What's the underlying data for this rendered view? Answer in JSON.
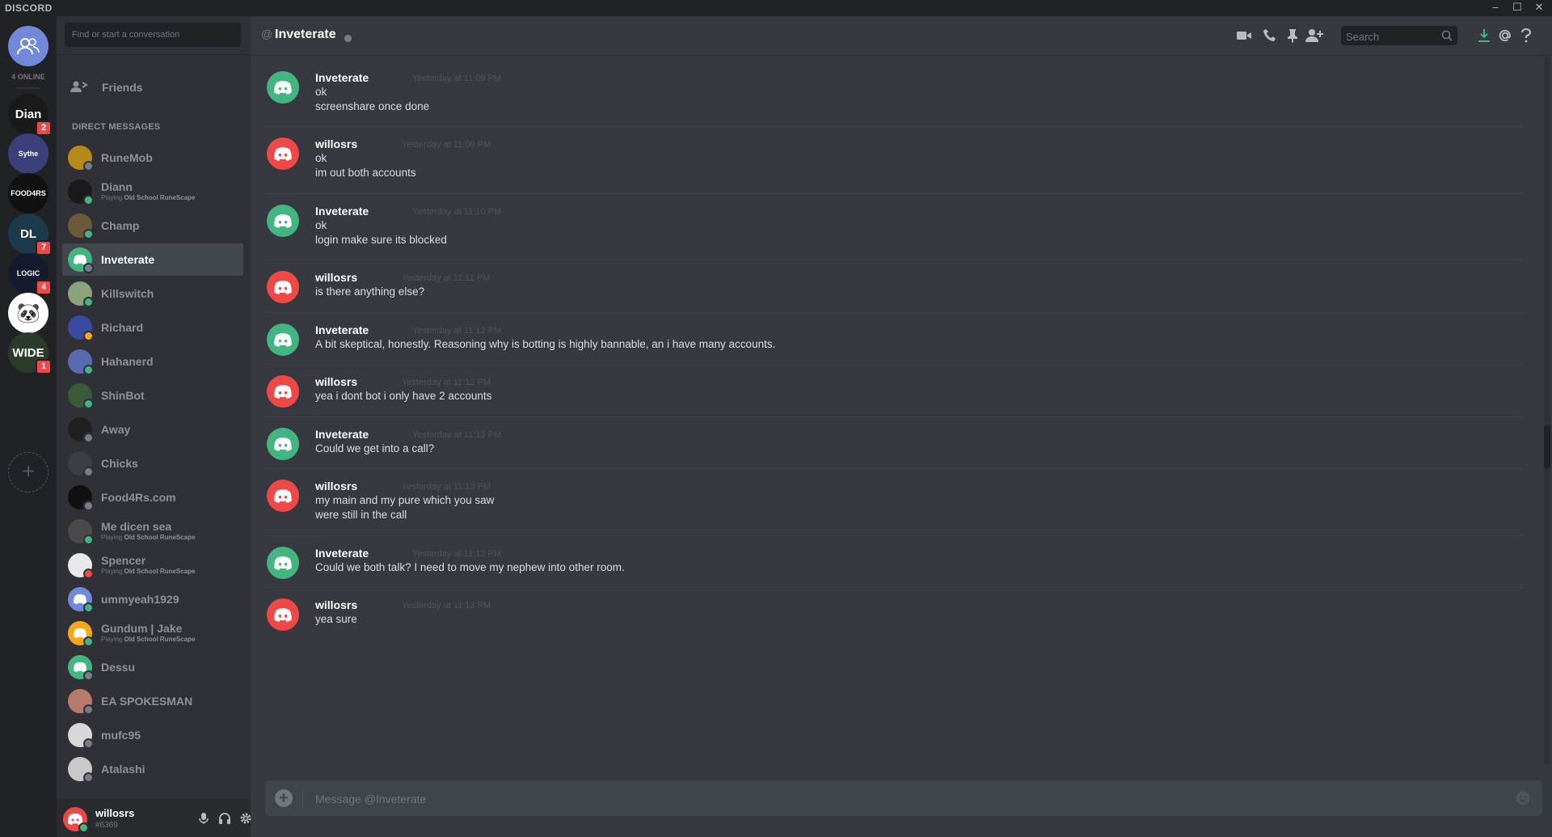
{
  "app": {
    "brand": "DISCORD",
    "window_controls": [
      "–",
      "☐",
      "✕"
    ]
  },
  "guild_bar": {
    "online_label": "4 ONLINE",
    "guilds": [
      {
        "name": "Diann",
        "letters": "Dian",
        "badge": "2",
        "color": "#1a1a1a"
      },
      {
        "name": "Sythe",
        "letters": "Sythe",
        "badge": "",
        "color": "#3b3f7a"
      },
      {
        "name": "Food4Rs",
        "letters": "FOOD4RS",
        "badge": "",
        "color": "#111111"
      },
      {
        "name": "DL",
        "letters": "DL",
        "badge": "7",
        "color": "#1c3a4a"
      },
      {
        "name": "Logic",
        "letters": "LOGIC",
        "badge": "4",
        "color": "#151a2e"
      },
      {
        "name": "Panda",
        "letters": "🐼",
        "badge": "",
        "color": "#ffffff"
      },
      {
        "name": "Wide",
        "letters": "WIDE",
        "badge": "1",
        "color": "#2a3b2a"
      }
    ]
  },
  "sidebar": {
    "search_placeholder": "Find or start a conversation",
    "friends_label": "Friends",
    "dm_header": "DIRECT MESSAGES",
    "dms": [
      {
        "name": "RuneMob",
        "sub": "",
        "sub_game": "",
        "status": "#747f8d",
        "avatar": "#b58a1a",
        "active": false
      },
      {
        "name": "Diann",
        "sub": "Playing ",
        "sub_game": "Old School RuneScape",
        "status": "#43b581",
        "avatar": "#1a1a1a",
        "active": false
      },
      {
        "name": "Champ",
        "sub": "",
        "sub_game": "",
        "status": "#43b581",
        "avatar": "#6b5a3a",
        "active": false
      },
      {
        "name": "Inveterate",
        "sub": "",
        "sub_game": "",
        "status": "#747f8d",
        "avatar": "#43b581",
        "active": true
      },
      {
        "name": "Killswitch",
        "sub": "",
        "sub_game": "",
        "status": "#43b581",
        "avatar": "#8aa37a",
        "active": false
      },
      {
        "name": "Richard",
        "sub": "",
        "sub_game": "",
        "status": "#faa61a",
        "avatar": "#3a4aa0",
        "active": false
      },
      {
        "name": "Hahanerd",
        "sub": "",
        "sub_game": "",
        "status": "#43b581",
        "avatar": "#5a6ab0",
        "active": false
      },
      {
        "name": "ShinBot",
        "sub": "",
        "sub_game": "",
        "status": "#43b581",
        "avatar": "#3a5a3a",
        "active": false
      },
      {
        "name": "Away",
        "sub": "",
        "sub_game": "",
        "status": "#747f8d",
        "avatar": "#202020",
        "active": false
      },
      {
        "name": "Chicks",
        "sub": "",
        "sub_game": "",
        "status": "#747f8d",
        "avatar": "#3a3f45",
        "active": false
      },
      {
        "name": "Food4Rs.com",
        "sub": "",
        "sub_game": "",
        "status": "#747f8d",
        "avatar": "#111111",
        "active": false
      },
      {
        "name": "Me dicen sea",
        "sub": "Playing ",
        "sub_game": "Old School RuneScape",
        "status": "#43b581",
        "avatar": "#4a4a4a",
        "active": false
      },
      {
        "name": "Spencer",
        "sub": "Playing ",
        "sub_game": "Old School RuneScape",
        "status": "#f04747",
        "avatar": "#e8e8e8",
        "active": false
      },
      {
        "name": "ummyeah1929",
        "sub": "",
        "sub_game": "",
        "status": "#43b581",
        "avatar": "#7289da",
        "active": false
      },
      {
        "name": "Gundum | Jake",
        "sub": "Playing ",
        "sub_game": "Old School RuneScape",
        "status": "#43b581",
        "avatar": "#faa61a",
        "active": false
      },
      {
        "name": "Dessu",
        "sub": "",
        "sub_game": "",
        "status": "#747f8d",
        "avatar": "#43b581",
        "active": false
      },
      {
        "name": "EA SPOKESMAN",
        "sub": "",
        "sub_game": "",
        "status": "#747f8d",
        "avatar": "#b87a6a",
        "active": false
      },
      {
        "name": "mufc95",
        "sub": "",
        "sub_game": "",
        "status": "#747f8d",
        "avatar": "#d8d8d8",
        "active": false
      },
      {
        "name": "Atalashi",
        "sub": "",
        "sub_game": "",
        "status": "#747f8d",
        "avatar": "#c8c8c8",
        "active": false
      }
    ]
  },
  "user_panel": {
    "username": "willosrs",
    "discriminator": "#6369"
  },
  "header": {
    "at_symbol": "@",
    "title": "Inveterate",
    "search_placeholder": "Search",
    "icons": [
      "video-icon",
      "phone-icon",
      "pin-icon",
      "add-friend-icon",
      "download-icon",
      "mention-icon",
      "help-icon"
    ]
  },
  "messages": [
    {
      "author": "Inveterate",
      "time": "Yesterday at 11:09 PM",
      "lines": [
        "ok",
        "screenshare once done"
      ],
      "color": "#43b581"
    },
    {
      "author": "willosrs",
      "time": "Yesterday at 11:09 PM",
      "lines": [
        "ok",
        "im out both accounts"
      ],
      "color": "#f04747"
    },
    {
      "author": "Inveterate",
      "time": "Yesterday at 11:10 PM",
      "lines": [
        "ok",
        "login make sure its blocked"
      ],
      "color": "#43b581"
    },
    {
      "author": "willosrs",
      "time": "Yesterday at 11:11 PM",
      "lines": [
        "is there anything else?"
      ],
      "color": "#f04747"
    },
    {
      "author": "Inveterate",
      "time": "Yesterday at 11:12 PM",
      "lines": [
        "A bit skeptical, honestly. Reasoning why is botting is highly bannable, an i have many accounts."
      ],
      "color": "#43b581"
    },
    {
      "author": "willosrs",
      "time": "Yesterday at 11:12 PM",
      "lines": [
        "yea i dont bot i only have 2 accounts"
      ],
      "color": "#f04747"
    },
    {
      "author": "Inveterate",
      "time": "Yesterday at 11:13 PM",
      "lines": [
        "Could we get into a call?"
      ],
      "color": "#43b581"
    },
    {
      "author": "willosrs",
      "time": "Yesterday at 11:13 PM",
      "lines": [
        "my main and my pure which you saw",
        "were still in the call"
      ],
      "color": "#f04747"
    },
    {
      "author": "Inveterate",
      "time": "Yesterday at 11:13 PM",
      "lines": [
        "Could we both talk? I need to move my nephew into other room."
      ],
      "color": "#43b581"
    },
    {
      "author": "willosrs",
      "time": "Yesterday at 11:13 PM",
      "lines": [
        "yea sure"
      ],
      "color": "#f04747"
    }
  ],
  "composer": {
    "placeholder": "Message @Inveterate"
  }
}
